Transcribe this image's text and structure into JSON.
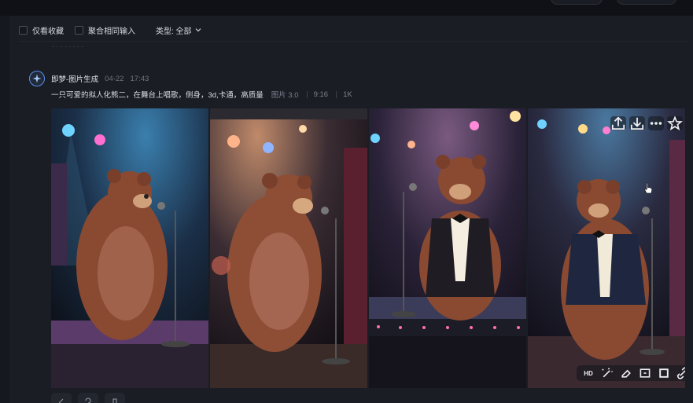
{
  "filters": {
    "favorites_only": "仅看收藏",
    "merge_same_input": "聚合相同输入",
    "type_label": "类型: 全部"
  },
  "message": {
    "source": "即梦-图片生成",
    "date": "04-22",
    "time": "17:43",
    "prompt": "一只可爱的拟人化熊二，在舞台上唱歌，侧身，3d,卡通，高质量",
    "model": "图片 3.0",
    "ratio": "9:16",
    "resolution": "1K"
  },
  "image_toolbar": {
    "hd_label": "HD"
  },
  "colors": {
    "background": "#15181f",
    "panel": "#1a1d24",
    "accent": "#5b8ee6"
  },
  "icons": {
    "top_actions": [
      "share-icon",
      "download-icon",
      "more-icon",
      "star-icon"
    ],
    "bottom_actions": [
      "hd-icon",
      "magic-wand-icon",
      "eraser-icon",
      "expand-icon",
      "crop-icon",
      "link-icon"
    ]
  }
}
